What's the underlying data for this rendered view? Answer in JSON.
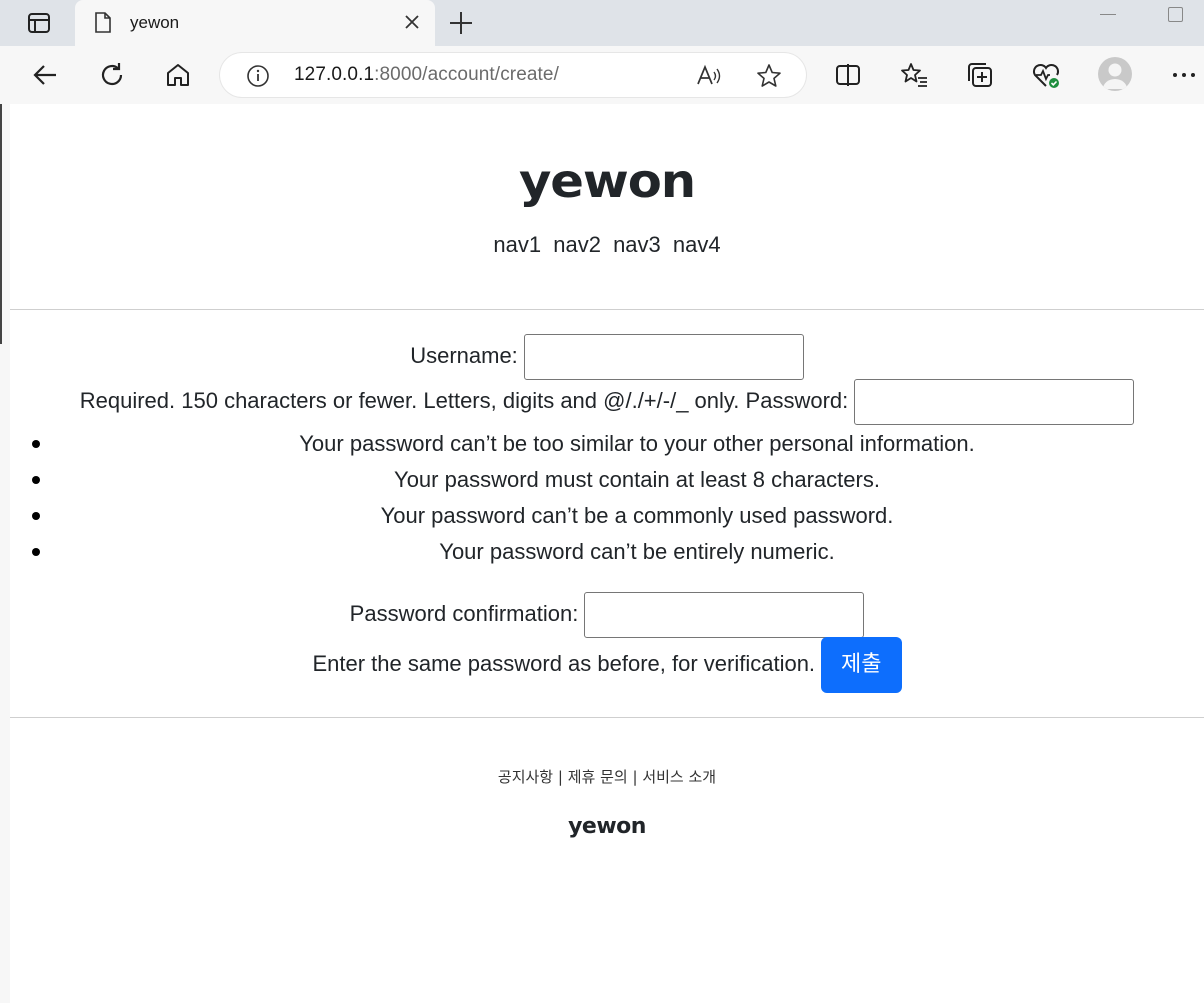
{
  "browser": {
    "tab_title": "yewon",
    "url_host": "127.0.0.1",
    "url_rest": ":8000/account/create/"
  },
  "site": {
    "brand": "yewon",
    "nav": [
      "nav1",
      "nav2",
      "nav3",
      "nav4"
    ]
  },
  "form": {
    "username_label": "Username:",
    "username_value": "",
    "username_help": "Required. 150 characters or fewer. Letters, digits and @/./+/-/_ only.",
    "password_label": "Password:",
    "password_value": "",
    "password_rules": [
      "Your password can’t be too similar to your other personal information.",
      "Your password must contain at least 8 characters.",
      "Your password can’t be a commonly used password.",
      "Your password can’t be entirely numeric."
    ],
    "confirm_label": "Password confirmation:",
    "confirm_value": "",
    "confirm_help": "Enter the same password as before, for verification.",
    "submit_label": "제출"
  },
  "footer": {
    "links": [
      "공지사항",
      "제휴 문의",
      "서비스 소개"
    ],
    "separator": "|",
    "brand": "yewon"
  },
  "colors": {
    "accent": "#0d6efd",
    "text": "#212529",
    "tab_strip": "#dfe3e8",
    "toolbar": "#f7f7f7"
  },
  "icons": {
    "back": "arrow-left-icon",
    "refresh": "refresh-icon",
    "home": "home-icon",
    "info": "info-icon",
    "read_aloud": "read-aloud-icon",
    "favorite": "star-icon",
    "split": "split-screen-icon",
    "favorites_list": "favorites-icon",
    "collections": "collections-icon",
    "health": "browser-essentials-icon",
    "menu": "more-icon"
  }
}
